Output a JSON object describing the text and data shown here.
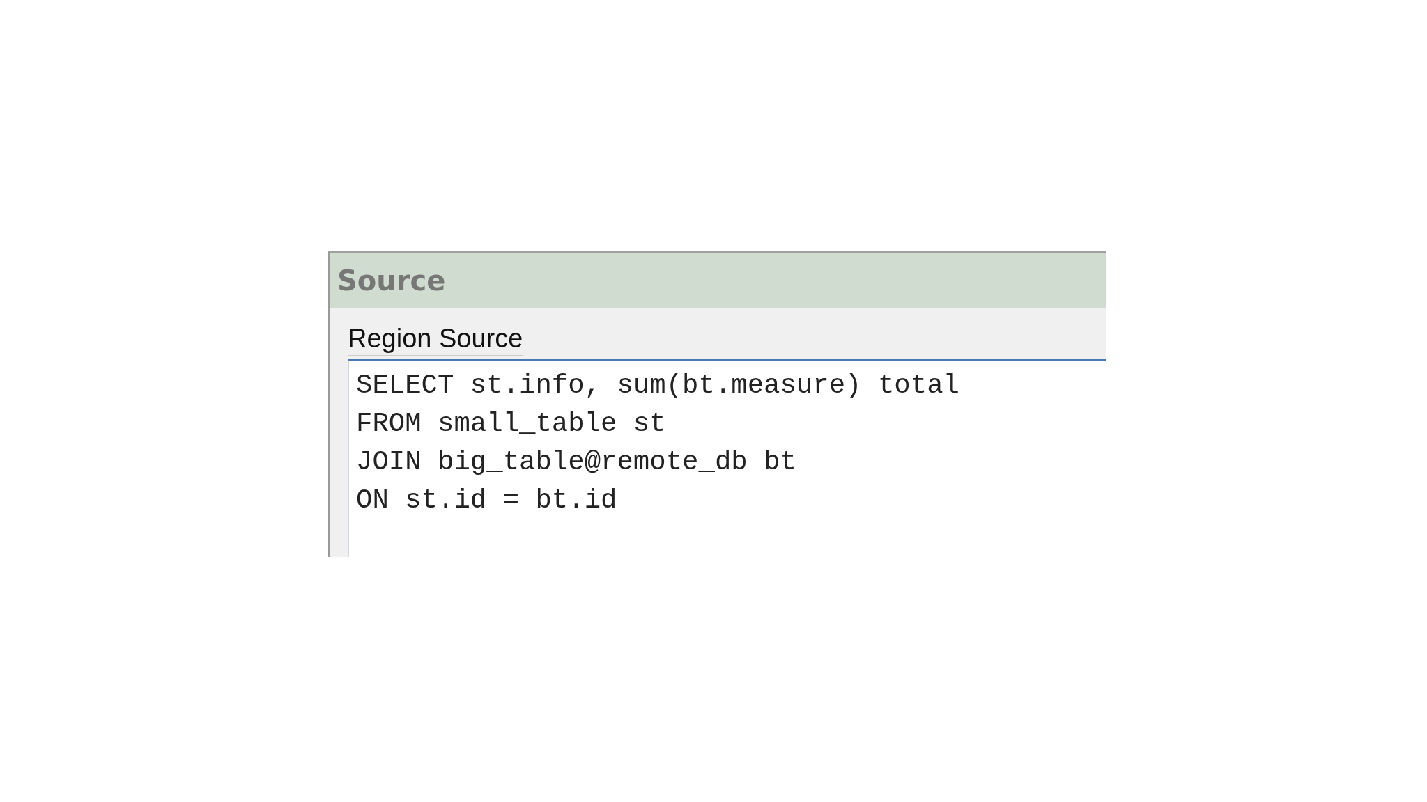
{
  "panel": {
    "title": "Source"
  },
  "field": {
    "label": "Region Source",
    "lines": [
      "SELECT st.info, sum(bt.measure) total",
      "FROM small_table st",
      "JOIN big_table@remote_db bt",
      "ON st.id = bt.id"
    ]
  }
}
